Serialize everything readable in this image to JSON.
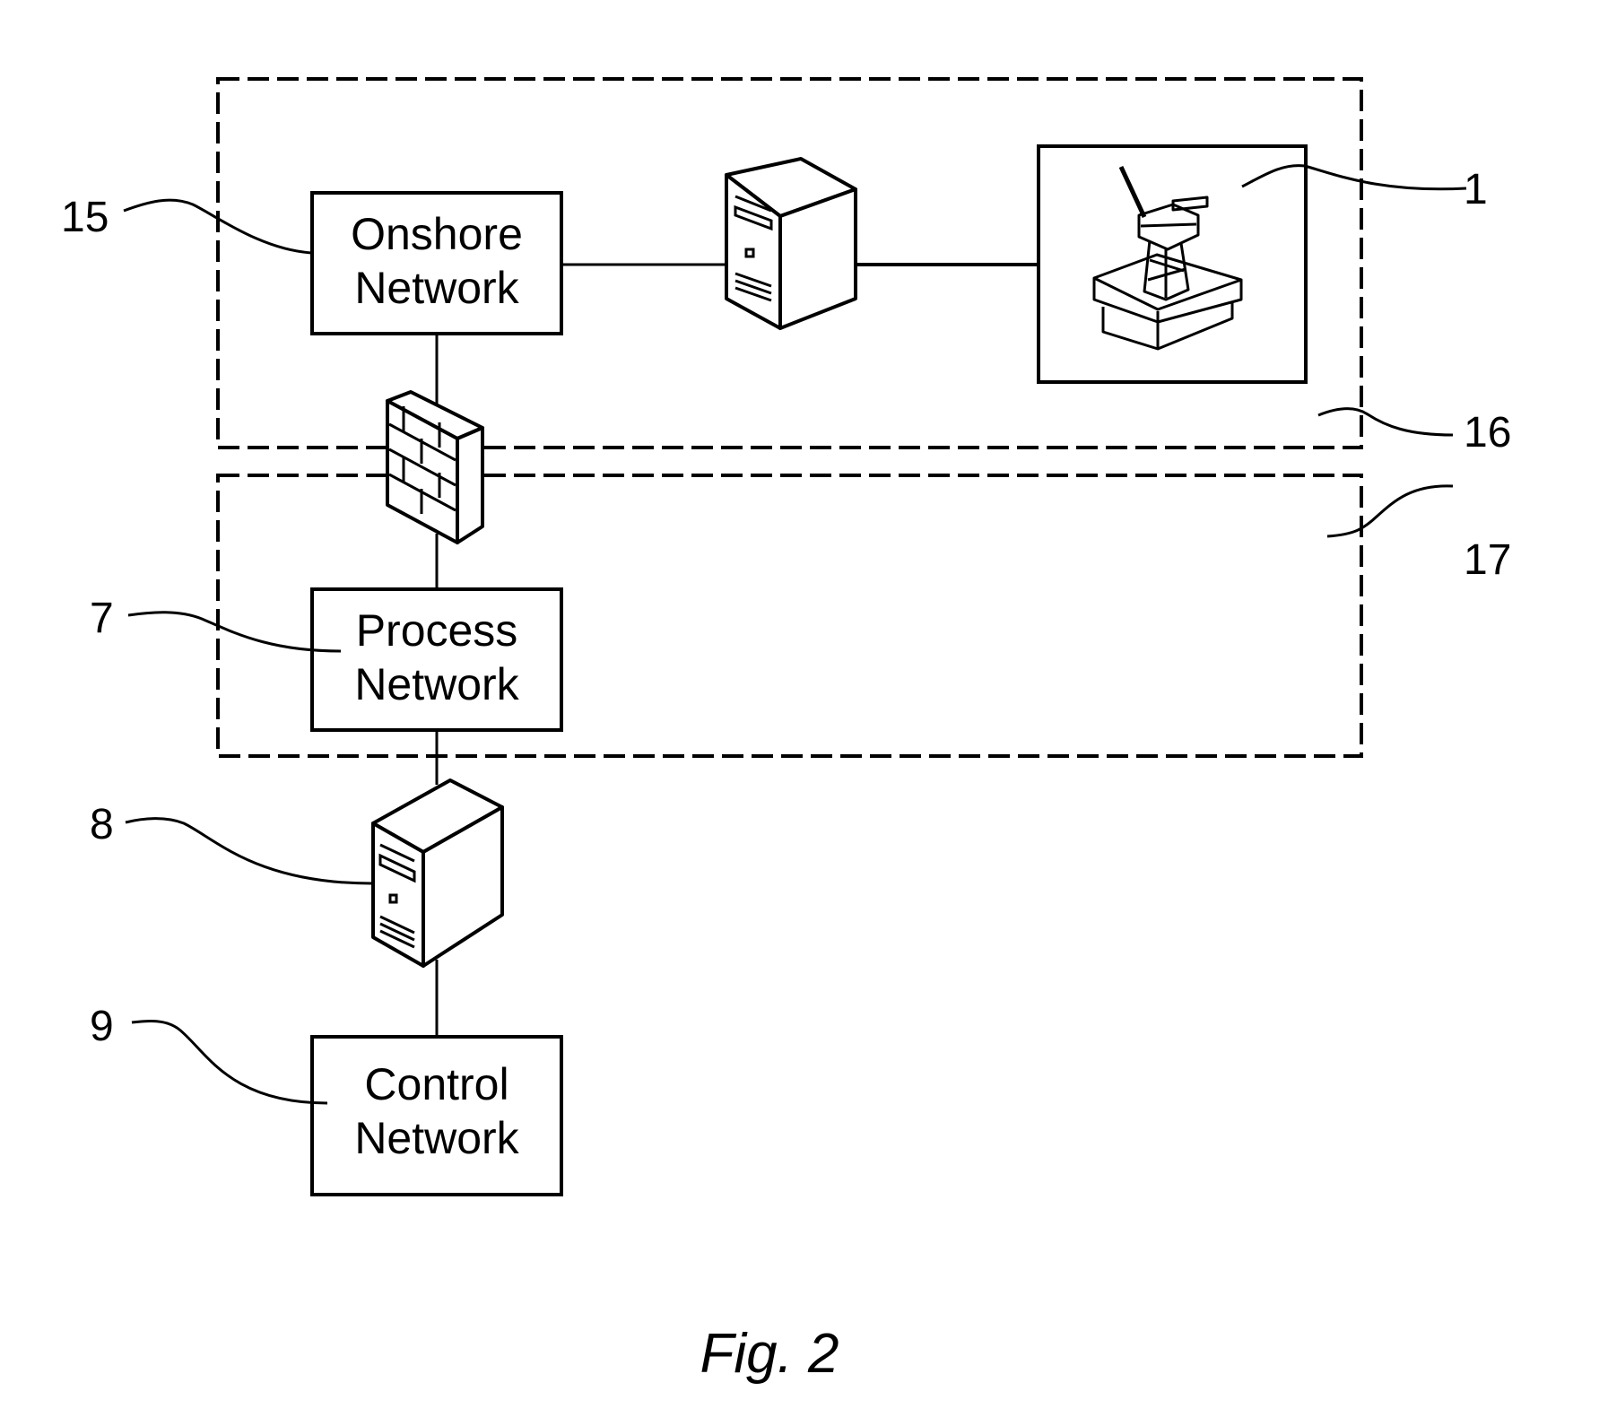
{
  "figure": {
    "caption": "Fig. 2",
    "zones": [
      {
        "ref": "16",
        "description": "onshore zone (dashed boundary)"
      },
      {
        "ref": "17",
        "description": "process zone (dashed boundary)"
      }
    ],
    "nodes": {
      "onshore_network": {
        "ref": "15",
        "line1": "Onshore",
        "line2": "Network"
      },
      "process_network": {
        "ref": "7",
        "line1": "Process",
        "line2": "Network"
      },
      "control_network": {
        "ref": "9",
        "line1": "Control",
        "line2": "Network"
      },
      "server_onshore": {
        "icon": "server-icon"
      },
      "firewall": {
        "icon": "firewall-icon"
      },
      "server_control": {
        "ref": "8",
        "icon": "server-icon"
      },
      "platform": {
        "ref": "1",
        "icon": "offshore-platform-icon"
      }
    },
    "connections": [
      [
        "onshore_network",
        "server_onshore"
      ],
      [
        "server_onshore",
        "platform"
      ],
      [
        "onshore_network",
        "firewall"
      ],
      [
        "firewall",
        "process_network"
      ],
      [
        "process_network",
        "server_control"
      ],
      [
        "server_control",
        "control_network"
      ]
    ]
  }
}
